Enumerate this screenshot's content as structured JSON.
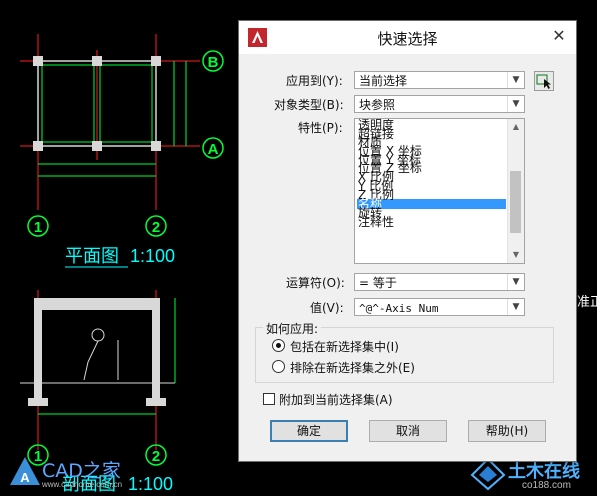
{
  "dialog": {
    "title": "快速选择",
    "close_glyph": "✕",
    "apply_to_label": "应用到(Y):",
    "apply_to_value": "当前选择",
    "object_type_label": "对象类型(B):",
    "object_type_value": "块参照",
    "properties_label": "特性(P):",
    "properties": [
      "透明度",
      "超链接",
      "材质",
      "位置 X 坐标",
      "位置 Y 坐标",
      "位置 Z 坐标",
      "X 比例",
      "Y 比例",
      "Z 比例",
      "名称",
      "旋转",
      "注释性"
    ],
    "selected_property": "名称",
    "operator_label": "运算符(O):",
    "operator_value": "= 等于",
    "value_label": "值(V):",
    "value_value": "^@^-Axis Num",
    "how_to_apply_label": "如何应用:",
    "radio_include": "包括在新选择集中(I)",
    "radio_exclude": "排除在新选择集之外(E)",
    "append_label": "附加到当前选择集(A)",
    "ok_label": "确定",
    "cancel_label": "取消",
    "help_label": "帮助(H)"
  },
  "cad": {
    "plan_title": "平面图",
    "plan_scale": "1:100",
    "section_title": "剖面图",
    "section_scale": "1:100",
    "axis_b": "B",
    "axis_a": "A",
    "axis_1": "1",
    "axis_2": "2",
    "side_text": "准正",
    "colors": {
      "line_red": "#ff2020",
      "line_green": "#00ff33",
      "label_cyan": "#00ffff",
      "pale": "#d8d8d8"
    }
  },
  "watermarks": {
    "left_text": "CAD之家",
    "left_url": "www.cadhome.com.cn",
    "right_text": "土木在线",
    "right_url": "co188.com"
  }
}
